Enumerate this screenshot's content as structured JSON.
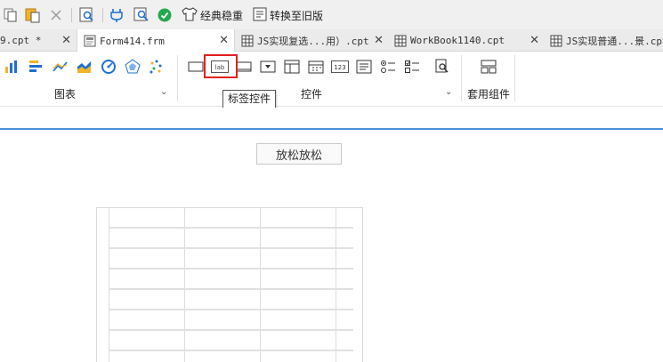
{
  "quick_toolbar": {
    "items": [
      {
        "icon": "copy-icon"
      },
      {
        "icon": "paste-icon"
      },
      {
        "icon": "close-icon"
      },
      {
        "icon": "preview-icon"
      },
      {
        "icon": "plugin-icon"
      },
      {
        "icon": "search-doc-icon"
      },
      {
        "icon": "check-circle-icon",
        "color": "#22a94f"
      },
      {
        "icon": "shirt-icon",
        "label": "经典稳重"
      },
      {
        "icon": "convert-icon",
        "label": "转换至旧版"
      }
    ]
  },
  "tabs": [
    {
      "name": "9.cpt *",
      "active": false
    },
    {
      "name": "Form414.frm",
      "active": true
    },
    {
      "name": "JS实现复选...用）.cpt",
      "active": false
    },
    {
      "name": "WorkBook1140.cpt",
      "active": false
    },
    {
      "name": "JS实现普通...景.cpt",
      "active": false
    }
  ],
  "ribbon": {
    "chart_group": {
      "label": "图表",
      "icons": [
        "bar-chart-icon",
        "horizontal-bar-icon",
        "line-chart-icon",
        "area-chart-icon",
        "gauge-icon",
        "radar-chart-icon",
        "scatter-chart-icon"
      ]
    },
    "control_group": {
      "label": "控件",
      "icons": [
        "textbox-icon",
        "label-icon",
        "textfield-icon",
        "combobox-icon",
        "frame-icon",
        "date-icon",
        "number-icon",
        "list-icon",
        "radio-group-icon",
        "checkbox-group-icon",
        "search-icon"
      ]
    },
    "common_group": {
      "label": "套用组件",
      "icons": [
        "components-icon"
      ]
    },
    "tooltip": "标签控件"
  },
  "canvas": {
    "button_label": "放松放松",
    "accent_color": "#4a90d9"
  },
  "colors": {
    "toolbar_bg": "#f0f0f0",
    "tabbar_bg": "#ebebeb",
    "highlight": "#e02020",
    "icon_blue": "#1e6fd0",
    "icon_yellow": "#f0b429",
    "icon_green": "#22a94f"
  }
}
